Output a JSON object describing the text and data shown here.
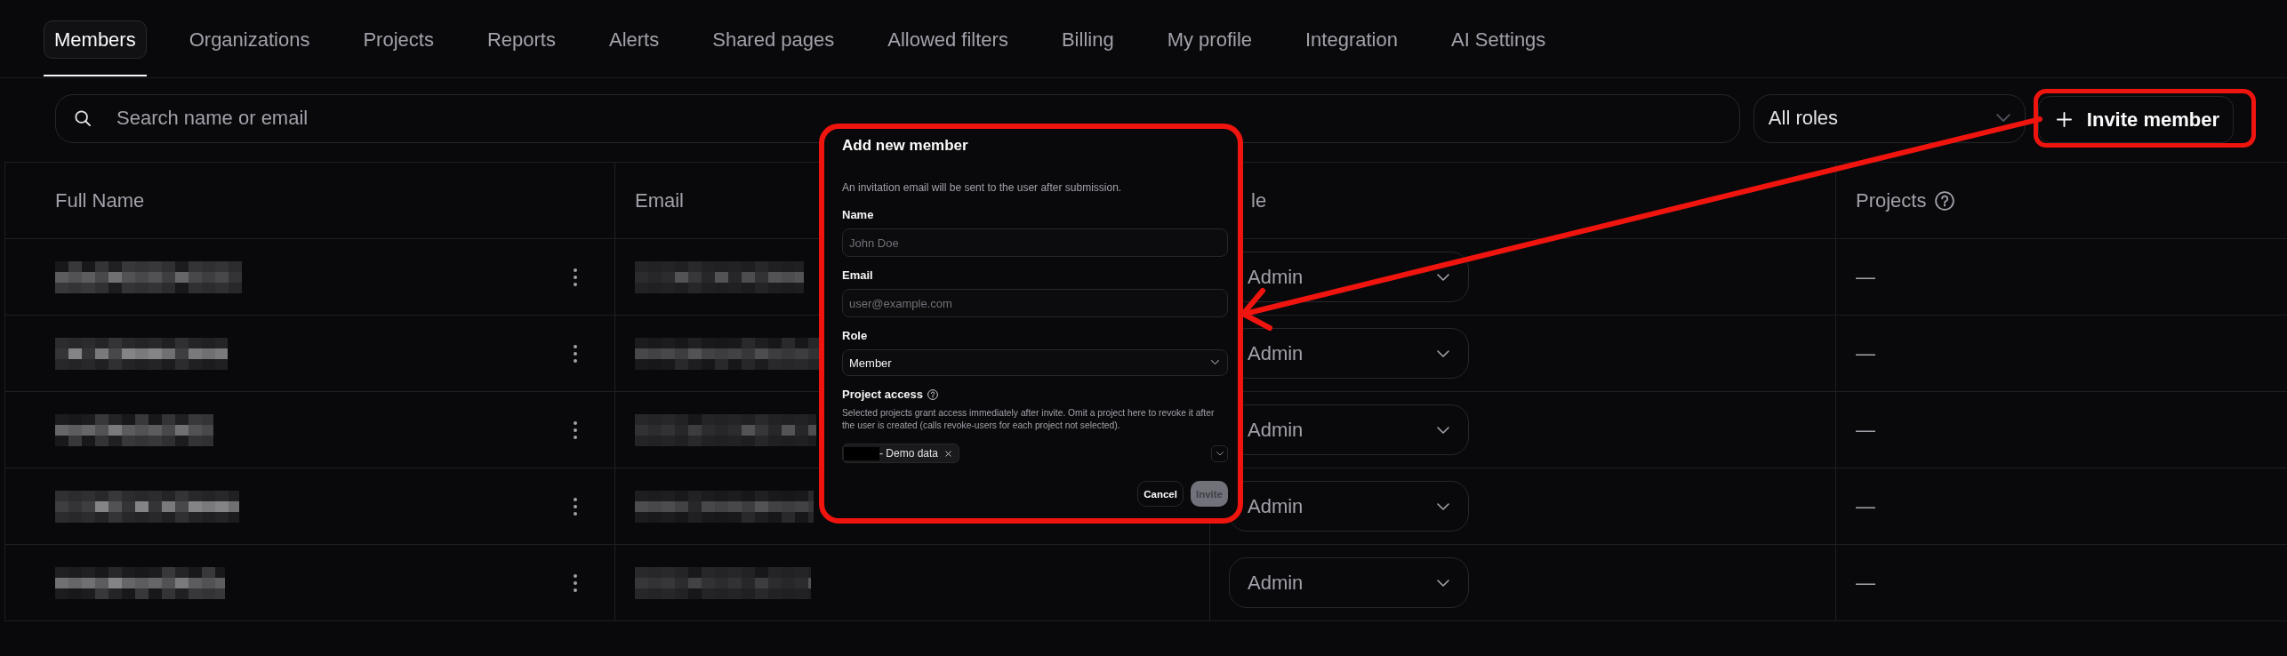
{
  "tabs": [
    {
      "label": "Members",
      "selected": true
    },
    {
      "label": "Organizations",
      "selected": false
    },
    {
      "label": "Projects",
      "selected": false
    },
    {
      "label": "Reports",
      "selected": false
    },
    {
      "label": "Alerts",
      "selected": false
    },
    {
      "label": "Shared pages",
      "selected": false
    },
    {
      "label": "Allowed filters",
      "selected": false
    },
    {
      "label": "Billing",
      "selected": false
    },
    {
      "label": "My profile",
      "selected": false
    },
    {
      "label": "Integration",
      "selected": false
    },
    {
      "label": "AI Settings",
      "selected": false
    }
  ],
  "toolbar": {
    "search": {
      "placeholder": "Search name or email"
    },
    "role_filter": {
      "value": "All roles"
    },
    "invite_button": {
      "label": "Invite member",
      "highlighted": true
    }
  },
  "table": {
    "columns": [
      {
        "label": "Full Name"
      },
      {
        "label": "Email"
      },
      {
        "label": "le"
      },
      {
        "label": "Projects",
        "help_icon": true
      }
    ],
    "rows": [
      {
        "role": "Admin",
        "projects": "—"
      },
      {
        "role": "Admin",
        "projects": "—"
      },
      {
        "role": "Admin",
        "projects": "—"
      },
      {
        "role": "Admin",
        "projects": "—"
      },
      {
        "role": "Admin",
        "projects": "—"
      }
    ]
  },
  "dialog": {
    "title": "Add new member",
    "highlighted": true,
    "description": "An invitation email will be sent to the user after submission.",
    "fields": [
      {
        "kind": "input",
        "label": "Name",
        "placeholder": "John Doe"
      },
      {
        "kind": "input",
        "label": "Email",
        "placeholder": "user@example.com"
      },
      {
        "kind": "select",
        "label": "Role",
        "value": "Member"
      },
      {
        "kind": "multiselect",
        "label": "Project access",
        "help_icon": true,
        "help": "Selected projects grant access immediately after invite. Omit a project here to revoke it after the user is created (calls revoke-users for each project not selected).",
        "chips": [
          {
            "label": "- Demo data"
          }
        ]
      }
    ],
    "buttons": [
      {
        "label": "Cancel",
        "kind": "secondary",
        "disabled": false
      },
      {
        "label": "Invite",
        "kind": "primary",
        "disabled": true
      }
    ]
  }
}
